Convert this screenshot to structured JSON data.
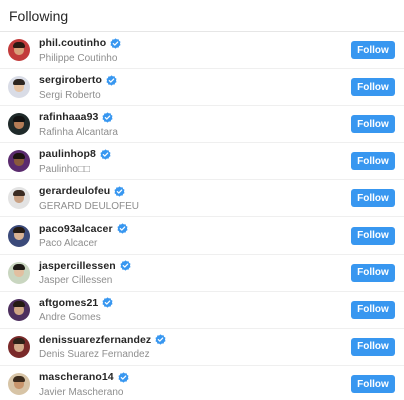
{
  "header": {
    "title": "Following"
  },
  "button_color": "#3897f0",
  "verified_color": "#3897f0",
  "users": [
    {
      "username": "phil.coutinho",
      "full_name": "Philippe Coutinho",
      "follow_label": "Follow",
      "verified": true,
      "avatar_bg": "#c23b3b",
      "avatar_face": "#d9a07a",
      "avatar_hair": "#2a1a12"
    },
    {
      "username": "sergiroberto",
      "full_name": "Sergi Roberto",
      "follow_label": "Follow",
      "verified": true,
      "avatar_bg": "#d9dce6",
      "avatar_face": "#e6c3a3",
      "avatar_hair": "#2c2520"
    },
    {
      "username": "rafinhaaa93",
      "full_name": "Rafinha Alcantara",
      "follow_label": "Follow",
      "verified": true,
      "avatar_bg": "#1f2a2a",
      "avatar_face": "#b47c56",
      "avatar_hair": "#111111"
    },
    {
      "username": "paulinhop8",
      "full_name": "Paulinho□□",
      "follow_label": "Follow",
      "verified": true,
      "avatar_bg": "#5a2b6e",
      "avatar_face": "#8a5a3c",
      "avatar_hair": "#1b1210"
    },
    {
      "username": "gerardeulofeu",
      "full_name": "GERARD DEULOFEU",
      "follow_label": "Follow",
      "verified": true,
      "avatar_bg": "#e3e3e3",
      "avatar_face": "#c9a184",
      "avatar_hair": "#3a2b22"
    },
    {
      "username": "paco93alcacer",
      "full_name": "Paco Alcacer",
      "follow_label": "Follow",
      "verified": true,
      "avatar_bg": "#3b4a7a",
      "avatar_face": "#d8b294",
      "avatar_hair": "#241a14"
    },
    {
      "username": "jaspercillessen",
      "full_name": "Jasper Cillessen",
      "follow_label": "Follow",
      "verified": true,
      "avatar_bg": "#c9d6c0",
      "avatar_face": "#e2bfa0",
      "avatar_hair": "#1e1a16"
    },
    {
      "username": "aftgomes21",
      "full_name": "Andre Gomes",
      "follow_label": "Follow",
      "verified": true,
      "avatar_bg": "#4d2f5e",
      "avatar_face": "#cfa584",
      "avatar_hair": "#241912"
    },
    {
      "username": "denissuarezfernandez",
      "full_name": "Denis Suarez Fernandez",
      "follow_label": "Follow",
      "verified": true,
      "avatar_bg": "#7a2a2a",
      "avatar_face": "#d4ac8c",
      "avatar_hair": "#2e2118"
    },
    {
      "username": "mascherano14",
      "full_name": "Javier Mascherano",
      "follow_label": "Follow",
      "verified": true,
      "avatar_bg": "#d7c4a6",
      "avatar_face": "#c8956c",
      "avatar_hair": "#3a2a1c"
    }
  ]
}
